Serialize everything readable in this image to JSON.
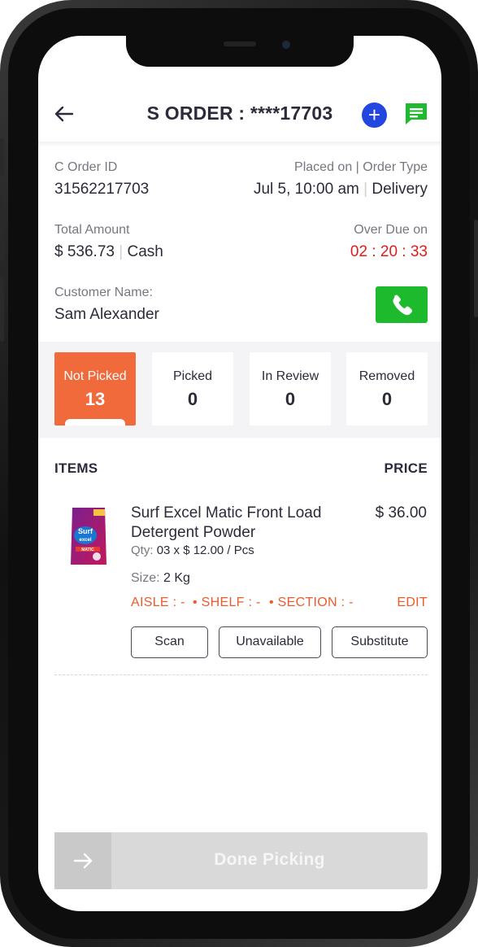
{
  "header": {
    "title": "S ORDER : ****17703",
    "add_icon": "plus-icon",
    "chat_icon": "chat-icon",
    "back_icon": "arrow-left-icon"
  },
  "order": {
    "c_order_id_label": "C Order ID",
    "c_order_id": "31562217703",
    "placed_label": "Placed on | Order Type",
    "placed_on": "Jul 5, 10:00 am",
    "order_type": "Delivery",
    "total_label": "Total Amount",
    "total_amount": "$ 536.73",
    "payment": "Cash",
    "overdue_label": "Over Due on",
    "overdue_time": "02 : 20 : 33",
    "customer_label": "Customer Name:",
    "customer_name": "Sam Alexander",
    "call_icon": "phone-icon"
  },
  "tabs": [
    {
      "label": "Not Picked",
      "count": "13"
    },
    {
      "label": "Picked",
      "count": "0"
    },
    {
      "label": "In Review",
      "count": "0"
    },
    {
      "label": "Removed",
      "count": "0"
    }
  ],
  "list": {
    "items_header": "ITEMS",
    "price_header": "PRICE"
  },
  "item": {
    "name": "Surf Excel Matic Front Load Detergent Powder",
    "price": "$ 36.00",
    "qty_label": "Qty:",
    "qty_value": "03 x $ 12.00 / Pcs",
    "size_label": "Size:",
    "size_value": "2 Kg",
    "aisle": "AISLE : -",
    "shelf": "SHELF : -",
    "section": "SECTION : -",
    "edit": "EDIT",
    "scan_button": "Scan",
    "unavailable_button": "Unavailable",
    "substitute_button": "Substitute"
  },
  "footer": {
    "done_label": "Done Picking",
    "arrow_icon": "arrow-right-icon"
  },
  "colors": {
    "accent_orange": "#f06a3c",
    "blue": "#2446e0",
    "green": "#1dba2d",
    "red": "#e51b1b"
  }
}
